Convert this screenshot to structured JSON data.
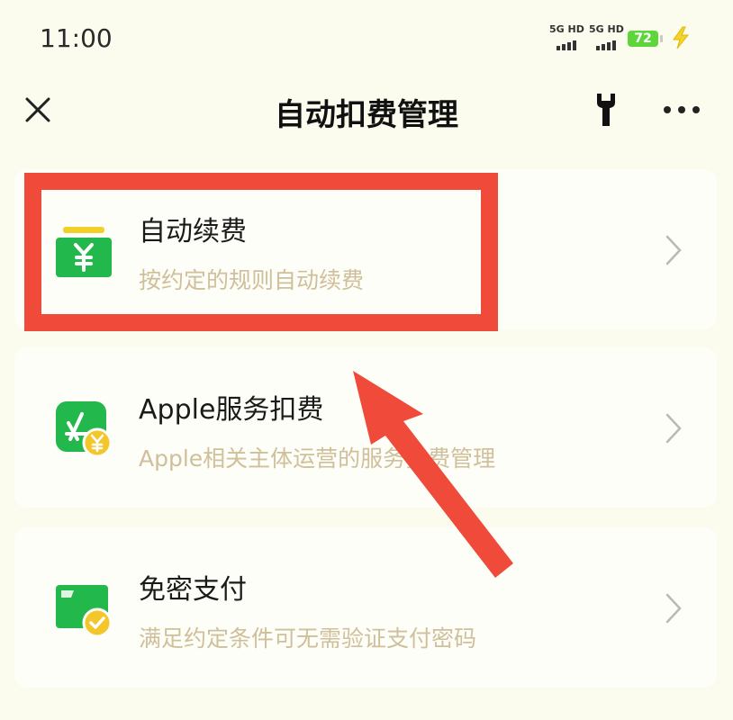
{
  "status_bar": {
    "time": "11:00",
    "signal_1": "5G HD",
    "signal_2": "5G HD",
    "battery": "72"
  },
  "nav": {
    "title": "自动扣费管理",
    "close_icon": "close-icon",
    "wrench_icon": "wrench-icon",
    "more_icon": "more-icon"
  },
  "items": [
    {
      "title": "自动续费",
      "subtitle": "按约定的规则自动续费",
      "icon": "yuan-wallet-icon"
    },
    {
      "title": "Apple服务扣费",
      "subtitle": "Apple相关主体运营的服务扣费管理",
      "icon": "app-store-yuan-icon"
    },
    {
      "title": "免密支付",
      "subtitle": "满足约定条件可无需验证支付密码",
      "icon": "card-check-icon"
    }
  ],
  "colors": {
    "background": "#fbfbee",
    "card": "#fefef8",
    "green": "#22b84c",
    "subtitle": "#cfbf9a",
    "annotation_red": "#f04a3a"
  }
}
